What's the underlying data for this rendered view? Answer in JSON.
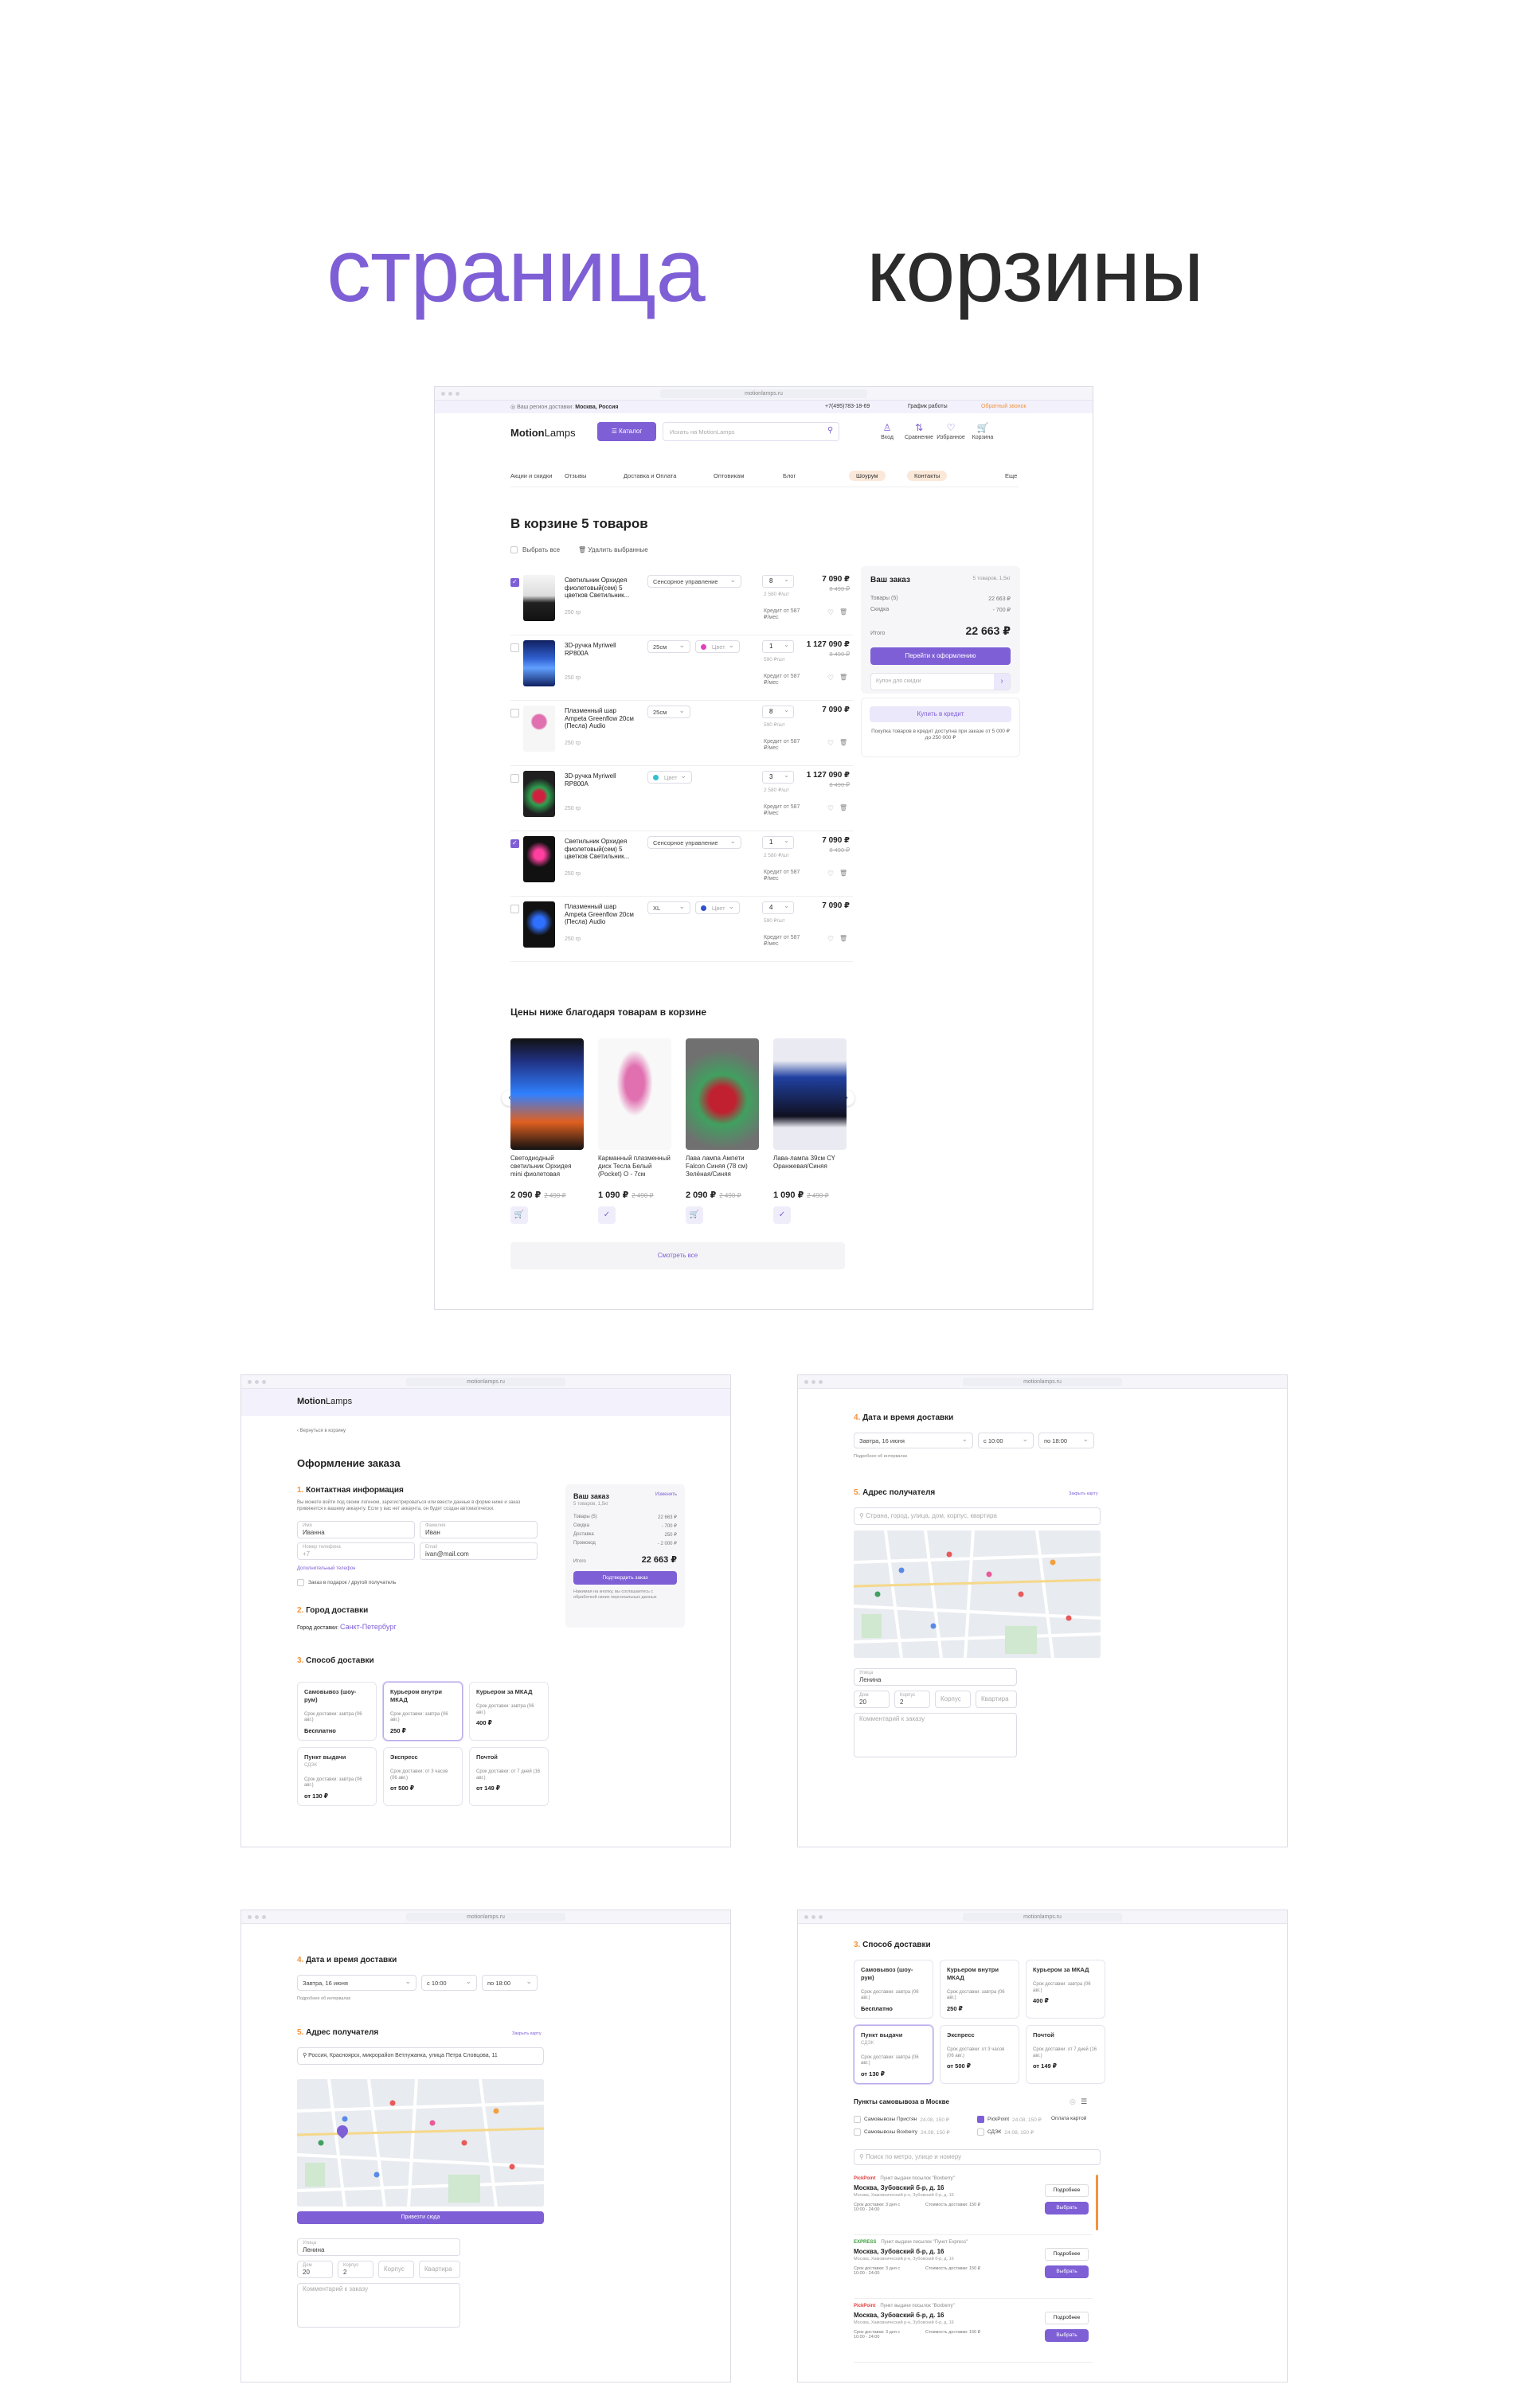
{
  "hero": {
    "word1": "страница",
    "word2": "корзины"
  },
  "browser": {
    "url": "motionlamps.ru"
  },
  "cart": {
    "topbar": {
      "region_prefix": "Ваш регион доставки:",
      "region": "Москва, Россия",
      "phone": "+7(495)783-18-69",
      "hours": "График работы",
      "callback": "Обратный звонок"
    },
    "logo_bold": "Motion",
    "logo_light": "Lamps",
    "catalog": "Каталог",
    "search_placeholder": "Искать на MotionLamps",
    "icons": [
      {
        "label": "Вход",
        "icon": "user-icon",
        "glyph": "♙"
      },
      {
        "label": "Сравнение",
        "icon": "compare-icon",
        "glyph": "⇅"
      },
      {
        "label": "Избранное",
        "icon": "heart-icon",
        "glyph": "♡"
      },
      {
        "label": "Корзина",
        "icon": "cart-icon",
        "glyph": "🛒"
      }
    ],
    "nav": [
      "Акции и скидки",
      "Отзывы",
      "Доставка и Оплата",
      "Оптовикам",
      "Блог",
      "Шоурум",
      "Контакты",
      "Еще"
    ],
    "title": "В корзине 5 товаров",
    "select_all": "Выбрать все",
    "delete_sel": "Удалить выбранные",
    "items": [
      {
        "name": "Светильник Орхидея фиолетовый(сем) 5 цветков Светильник...",
        "weight": "250 гр",
        "opt": "Сенсорное управление",
        "color": "",
        "qty": "8",
        "unit": "2 580 ₽/шт",
        "price": "7 090 ₽",
        "old": "8 490 ₽",
        "credit": "Кредит от 587 ₽/мес",
        "checked": true
      },
      {
        "name": "3D-ручка Myriwell RP800A",
        "weight": "250 гр",
        "opt": "25см",
        "color": "Цвет",
        "qty": "1",
        "unit": "590 ₽/шт",
        "price": "1 127 090 ₽",
        "old": "8 490 ₽",
        "credit": "Кредит от 587 ₽/мес",
        "checked": false
      },
      {
        "name": "Плазменный шар Ampeta Greenflow 20см (Песла) Audio",
        "weight": "250 гр",
        "opt": "25см",
        "color": "",
        "qty": "8",
        "unit": "590 ₽/шт",
        "price": "7 090 ₽",
        "old": "",
        "credit": "Кредит от 587 ₽/мес",
        "checked": false
      },
      {
        "name": "3D-ручка Myriwell RP800A",
        "weight": "250 гр",
        "opt": "",
        "color": "Цвет",
        "qty": "3",
        "unit": "2 580 ₽/шт",
        "price": "1 127 090 ₽",
        "old": "8 490 ₽",
        "credit": "Кредит от 587 ₽/мес",
        "checked": false
      },
      {
        "name": "Светильник Орхидея фиолетовый(сем) 5 цветков Светильник...",
        "weight": "250 гр",
        "opt": "Сенсорное управление",
        "color": "",
        "qty": "1",
        "unit": "2 580 ₽/шт",
        "price": "7 090 ₽",
        "old": "8 490 ₽",
        "credit": "Кредит от 587 ₽/мес",
        "checked": true
      },
      {
        "name": "Плазменный шар Ampeta Greenflow 20см (Песла) Audio",
        "weight": "250 гр",
        "opt": "XL",
        "color": "Цвет",
        "qty": "4",
        "unit": "590 ₽/шт",
        "price": "7 090 ₽",
        "old": "",
        "credit": "Кредит от 587 ₽/мес",
        "checked": false
      }
    ],
    "summary": {
      "title": "Ваш заказ",
      "count": "5 товаров, 1,5кг",
      "goods_label": "Товары (5)",
      "goods": "22 663 ₽",
      "discount_label": "Скидка",
      "discount": "- 700 ₽",
      "total_label": "Итого",
      "total": "22 663 ₽",
      "checkout": "Перейти к оформлению",
      "coupon": "Купон для скидки",
      "credit_btn": "Купить в кредит",
      "credit_note": "Покупка товаров в кредит доступна при заказе от 5 000 ₽ до 250 000 ₽"
    },
    "reco_title": "Цены ниже благодаря товарам в корзине",
    "reco": [
      {
        "name": "Светодиодный светильник Орхидея mini фиолетовая",
        "price": "2 090 ₽",
        "old": "2 490 ₽"
      },
      {
        "name": "Карманный плазменный диск Тесла Белый (Pocket) О - 7см",
        "price": "1 090 ₽",
        "old": "2 490 ₽"
      },
      {
        "name": "Лава лампа Ампети Falcon Синяя (78 см) Зелёная/Синяя",
        "price": "2 090 ₽",
        "old": "2 490 ₽"
      },
      {
        "name": "Лава-лампа 39см СҮ Оранжевая/Синяя",
        "price": "1 090 ₽",
        "old": "2 490 ₽"
      }
    ],
    "see_all": "Смотреть все"
  },
  "checkout": {
    "back": "Вернуться в корзину",
    "title": "Оформление заказа",
    "s1": {
      "n": "1.",
      "t": "Контактная информация",
      "note": "Вы можете войти под своим логином, зарегистрироваться или ввести данные в форме ниже и заказ привяжется к вашему аккаунту. Если у вас нет аккаунта, он будет создан автоматически.",
      "name_l": "Имя",
      "name": "Иванна",
      "last_l": "Фамилия",
      "last": "Иван",
      "phone_l": "Номер телефона",
      "phone": "+7",
      "email_l": "Email",
      "email": "ivan@mail.com",
      "extra": "Дополнительный телефон",
      "gift": "Заказ в подарок / другой получатель"
    },
    "s2": {
      "n": "2.",
      "t": "Город доставки",
      "label": "Город доставки:",
      "city": "Санкт-Петербург"
    },
    "s3": {
      "n": "3.",
      "t": "Способ доставки"
    },
    "summary": {
      "title": "Ваш заказ",
      "edit": "Изменить",
      "count": "5 товаров, 1,5кг",
      "rows": [
        [
          "Товары (5)",
          "22 663 ₽"
        ],
        [
          "Скидка",
          "- 700 ₽"
        ],
        [
          "Доставка",
          "250 ₽"
        ],
        [
          "Промокод",
          "- 2 000 ₽"
        ]
      ],
      "total_l": "Итого",
      "total": "22 663 ₽",
      "btn": "Подтвердить заказ",
      "note": "Нажимая на кнопку, вы соглашаетесь с обработкой своих персональных данных"
    },
    "methods": [
      {
        "t": "Самовывоз (шоу-рум)",
        "sub": "",
        "term": "Срок доставки: завтра (06 авг.)",
        "p": "Бесплатно"
      },
      {
        "t": "Курьером внутри МКАД",
        "sub": "",
        "term": "Срок доставки: завтра (06 авг.)",
        "p": "250 ₽"
      },
      {
        "t": "Курьером за МКАД",
        "sub": "",
        "term": "Срок доставки: завтра (06 авг.)",
        "p": "400 ₽"
      },
      {
        "t": "Пункт выдачи",
        "sub": "СДЭК",
        "term": "Срок доставки: завтра (06 авг.)",
        "p": "от 130 ₽"
      },
      {
        "t": "Экспресс",
        "sub": "",
        "term": "Срок доставки: от 3 часов (06 авг.)",
        "p": "от 500 ₽"
      },
      {
        "t": "Почтой",
        "sub": "",
        "term": "Срок доставки: от 7 дней (16 авг.)",
        "p": "от 149 ₽"
      }
    ]
  },
  "address": {
    "s4": {
      "n": "4.",
      "t": "Дата и время доставки",
      "date": "Завтра, 16 июня",
      "from": "с 10:00",
      "to": "по 18:00",
      "note": "Подробнее об интервалах"
    },
    "s5": {
      "n": "5.",
      "t": "Адрес получателя",
      "map_link": "Закрыть карту",
      "search_ph": "Страна, город, улица, дом, корпус, квартира",
      "search_val": "Россия, Красноярск, микрорайон Ветлужанка, улица Петра Словцова, 11",
      "street_l": "Улица",
      "street": "Ленина",
      "house_l": "Дом",
      "house": "20",
      "bld_l": "Корпус",
      "bld": "2",
      "ent": "Корпус",
      "flat": "Квартира",
      "comment": "Комментарий к заказу",
      "confirm": "Привезти сюда"
    }
  },
  "pickup": {
    "title": "Пункты самовывоза в Москве",
    "opts": [
      {
        "label": "Самовывозы Пристян",
        "meta": "24.08, 150 ₽",
        "on": false
      },
      {
        "label": "PickPoint",
        "meta": "24.08, 150 ₽",
        "on": true
      },
      {
        "label": "Оплата картой",
        "meta": "",
        "on": false
      },
      {
        "label": "Самовывозы Boxberry",
        "meta": "24.08, 150 ₽",
        "on": false
      },
      {
        "label": "СДЭК",
        "meta": "24.08, 150 ₽",
        "on": false
      }
    ],
    "search_ph": "Поиск по метро, улице и номеру",
    "points": [
      {
        "brand": "PickPoint",
        "hint": "Пункт выдачи посылок \"Boxberry\"",
        "addr": "Москва, Зубовский б-р, д. 16",
        "sub": "Москва, Хамовнический р-н, Зубовский б-р, д. 16",
        "term": "Срок доставки: 3 дня с 10:00 - 24:00",
        "cost": "Стоимость доставки: 150 ₽",
        "more": "Подробнее",
        "pick": "Выбрать"
      },
      {
        "brand": "EXPRESS",
        "hint": "Пункт выдачи посылок \"Пункт Express\"",
        "addr": "Москва, Зубовский б-р, д. 16",
        "sub": "Москва, Хамовнический р-н, Зубовский б-р, д. 16",
        "term": "Срок доставки: 3 дня с 10:00 - 24:00",
        "cost": "Стоимость доставки: 150 ₽",
        "more": "Подробнее",
        "pick": "Выбрать"
      },
      {
        "brand": "PickPoint",
        "hint": "Пункт выдачи посылок \"Boxberry\"",
        "addr": "Москва, Зубовский б-р, д. 16",
        "sub": "Москва, Хамовнический р-н, Зубовский б-р, д. 16",
        "term": "Срок доставки: 3 дня с 10:00 - 24:00",
        "cost": "Стоимость доставки: 150 ₽",
        "more": "Подробнее",
        "pick": "Выбрать"
      }
    ]
  }
}
